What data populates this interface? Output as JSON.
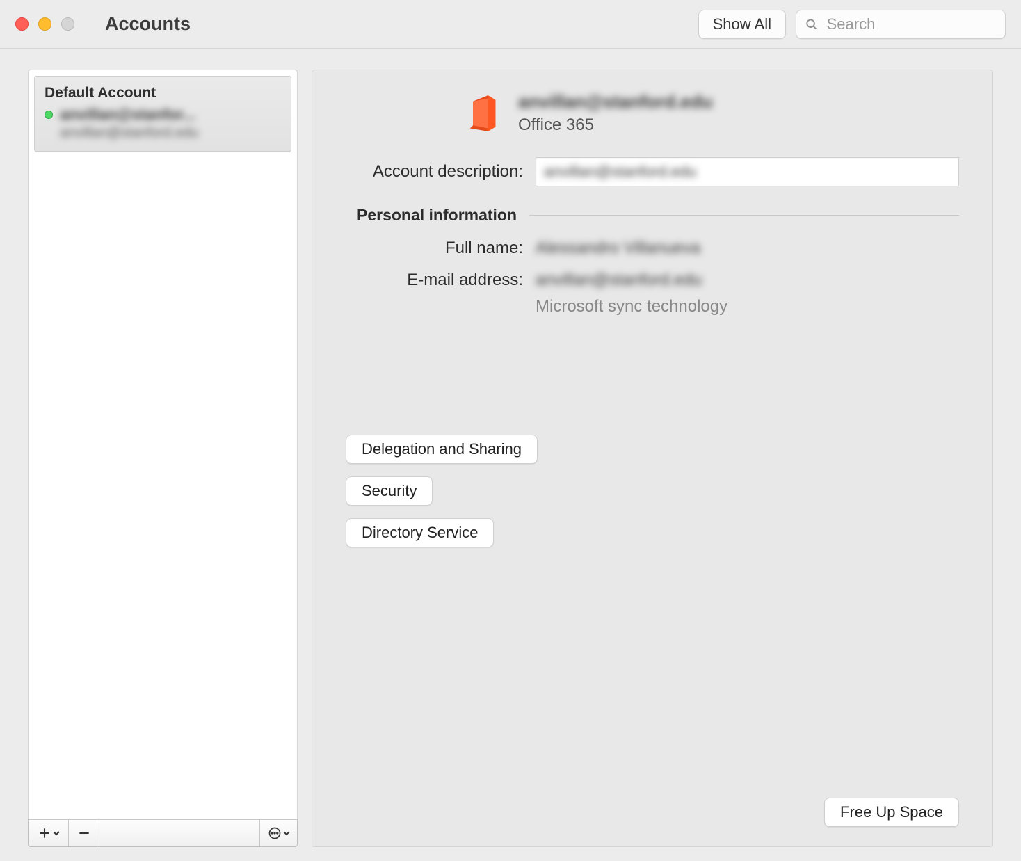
{
  "window": {
    "title": "Accounts",
    "show_all_label": "Show All",
    "search_placeholder": "Search"
  },
  "sidebar": {
    "default_label": "Default Account",
    "account_primary": "anvillan@stanfor...",
    "account_secondary": "anvillan@stanford.edu"
  },
  "detail": {
    "header_email": "anvillan@stanford.edu",
    "header_type": "Office 365",
    "account_description_label": "Account description:",
    "account_description_value": "anvillan@stanford.edu",
    "section_personal": "Personal information",
    "full_name_label": "Full name:",
    "full_name_value": "Alessandro Villanueva",
    "email_label": "E-mail address:",
    "email_value": "anvillan@stanford.edu",
    "sync_note": "Microsoft sync technology",
    "buttons": {
      "delegation": "Delegation and Sharing",
      "security": "Security",
      "directory": "Directory Service",
      "free_up": "Free Up Space"
    }
  }
}
